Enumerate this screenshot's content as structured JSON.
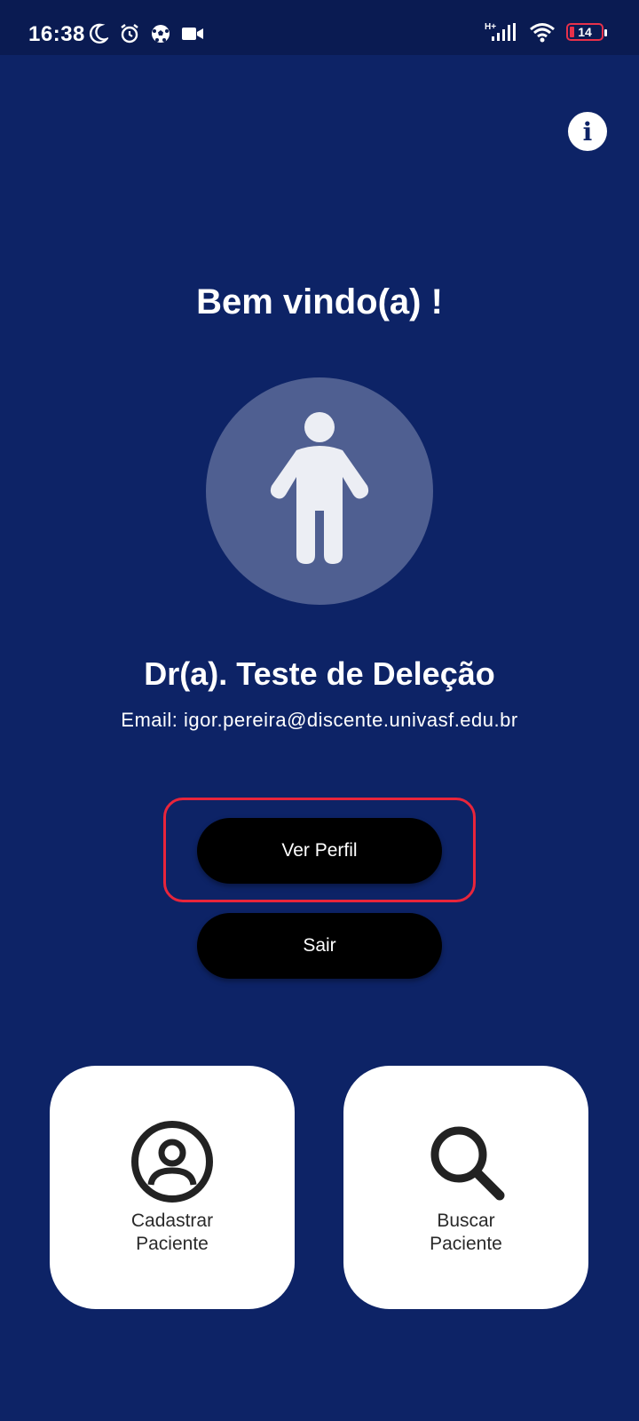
{
  "status_bar": {
    "time": "16:38",
    "network_label": "H+",
    "battery_level": "14",
    "left_icons": [
      "moon-icon",
      "alarm-icon",
      "soccer-ball-icon",
      "video-camera-icon"
    ],
    "right_icons": [
      "signal-icon",
      "wifi-icon",
      "battery-icon"
    ]
  },
  "header": {
    "info_icon": "info-icon",
    "info_glyph": "i"
  },
  "main": {
    "welcome": "Bem vindo(a) !",
    "avatar_icon": "person-icon",
    "doctor_name": "Dr(a). Teste de Deleção",
    "email": "Email: igor.pereira@discente.univasf.edu.br"
  },
  "actions": {
    "view_profile_label": "Ver Perfil",
    "logout_label": "Sair"
  },
  "tiles": {
    "register": {
      "icon": "user-circle-icon",
      "line1": "Cadastrar",
      "line2": "Paciente"
    },
    "search": {
      "icon": "search-icon",
      "line1": "Buscar",
      "line2": "Paciente"
    }
  },
  "colors": {
    "background": "#0d2366",
    "status_bar": "#0a1b52",
    "avatar_bg": "#4f5f91",
    "button_bg": "#000000",
    "highlight": "#e8253b",
    "battery_low": "#e8314a"
  }
}
